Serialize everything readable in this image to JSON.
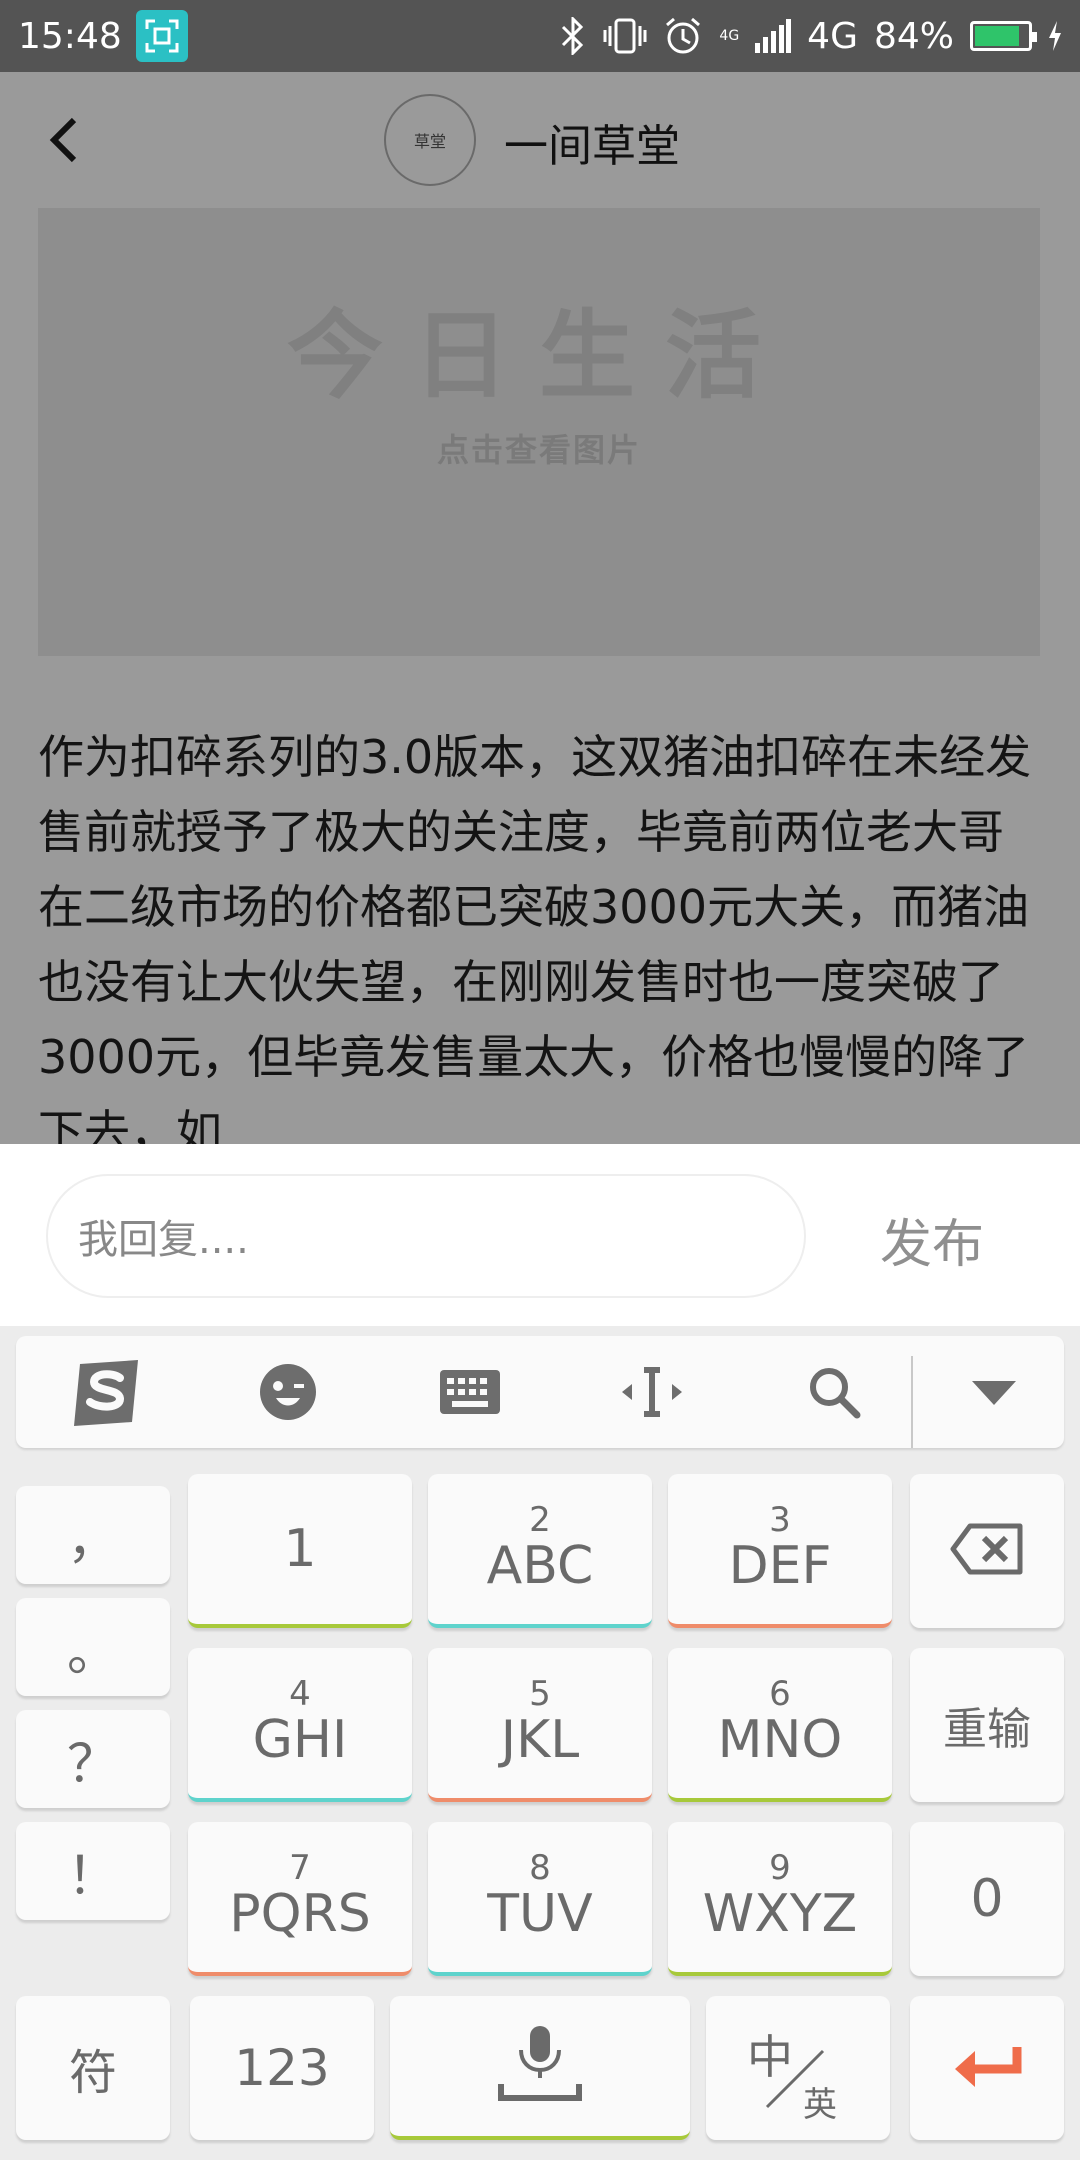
{
  "status_bar": {
    "time": "15:48",
    "network": "4G",
    "network_small": "4G",
    "battery": "84%",
    "battery_level": 0.84,
    "icons": [
      "screenshot-icon",
      "bluetooth-icon",
      "vibrate-icon",
      "alarm-icon",
      "signal-icon",
      "battery-icon",
      "charging-icon"
    ]
  },
  "header": {
    "avatar_text": "草堂",
    "title": "一间草堂"
  },
  "banner": {
    "main_text": "今日生活",
    "sub_text": "点击查看图片"
  },
  "article": {
    "text": "作为扣碎系列的3.0版本，这双猪油扣碎在未经发售前就授予了极大的关注度，毕竟前两位老大哥在二级市场的价格都已突破3000元大关，而猪油也没有让大伙失望，在刚刚发售时也一度突破了3000元，但毕竟发售量太大，价格也慢慢的降了下去，如"
  },
  "reply": {
    "placeholder": "我回复....",
    "publish_label": "发布"
  },
  "keyboard": {
    "toolbar_icons": [
      "sogou-logo-icon",
      "emoji-icon",
      "keyboard-icon",
      "cursor-move-icon",
      "search-icon",
      "collapse-keyboard-icon"
    ],
    "punctuation": [
      "，",
      "。",
      "？",
      "！"
    ],
    "keys": {
      "k1": {
        "num": "",
        "letters": "1"
      },
      "k2": {
        "num": "2",
        "letters": "ABC"
      },
      "k3": {
        "num": "3",
        "letters": "DEF"
      },
      "k4": {
        "num": "4",
        "letters": "GHI"
      },
      "k5": {
        "num": "5",
        "letters": "JKL"
      },
      "k6": {
        "num": "6",
        "letters": "MNO"
      },
      "k7": {
        "num": "7",
        "letters": "PQRS"
      },
      "k8": {
        "num": "8",
        "letters": "TUV"
      },
      "k9": {
        "num": "9",
        "letters": "WXYZ"
      }
    },
    "reenter_label": "重输",
    "zero_label": "0",
    "symbol_label": "符",
    "numbers_label": "123",
    "lang_main": "中",
    "lang_sub": "英",
    "accent_colors": {
      "green": "#a7c93a",
      "teal": "#5ed3cc",
      "orange": "#ef8c6a",
      "enter": "#ef6c4a"
    }
  }
}
